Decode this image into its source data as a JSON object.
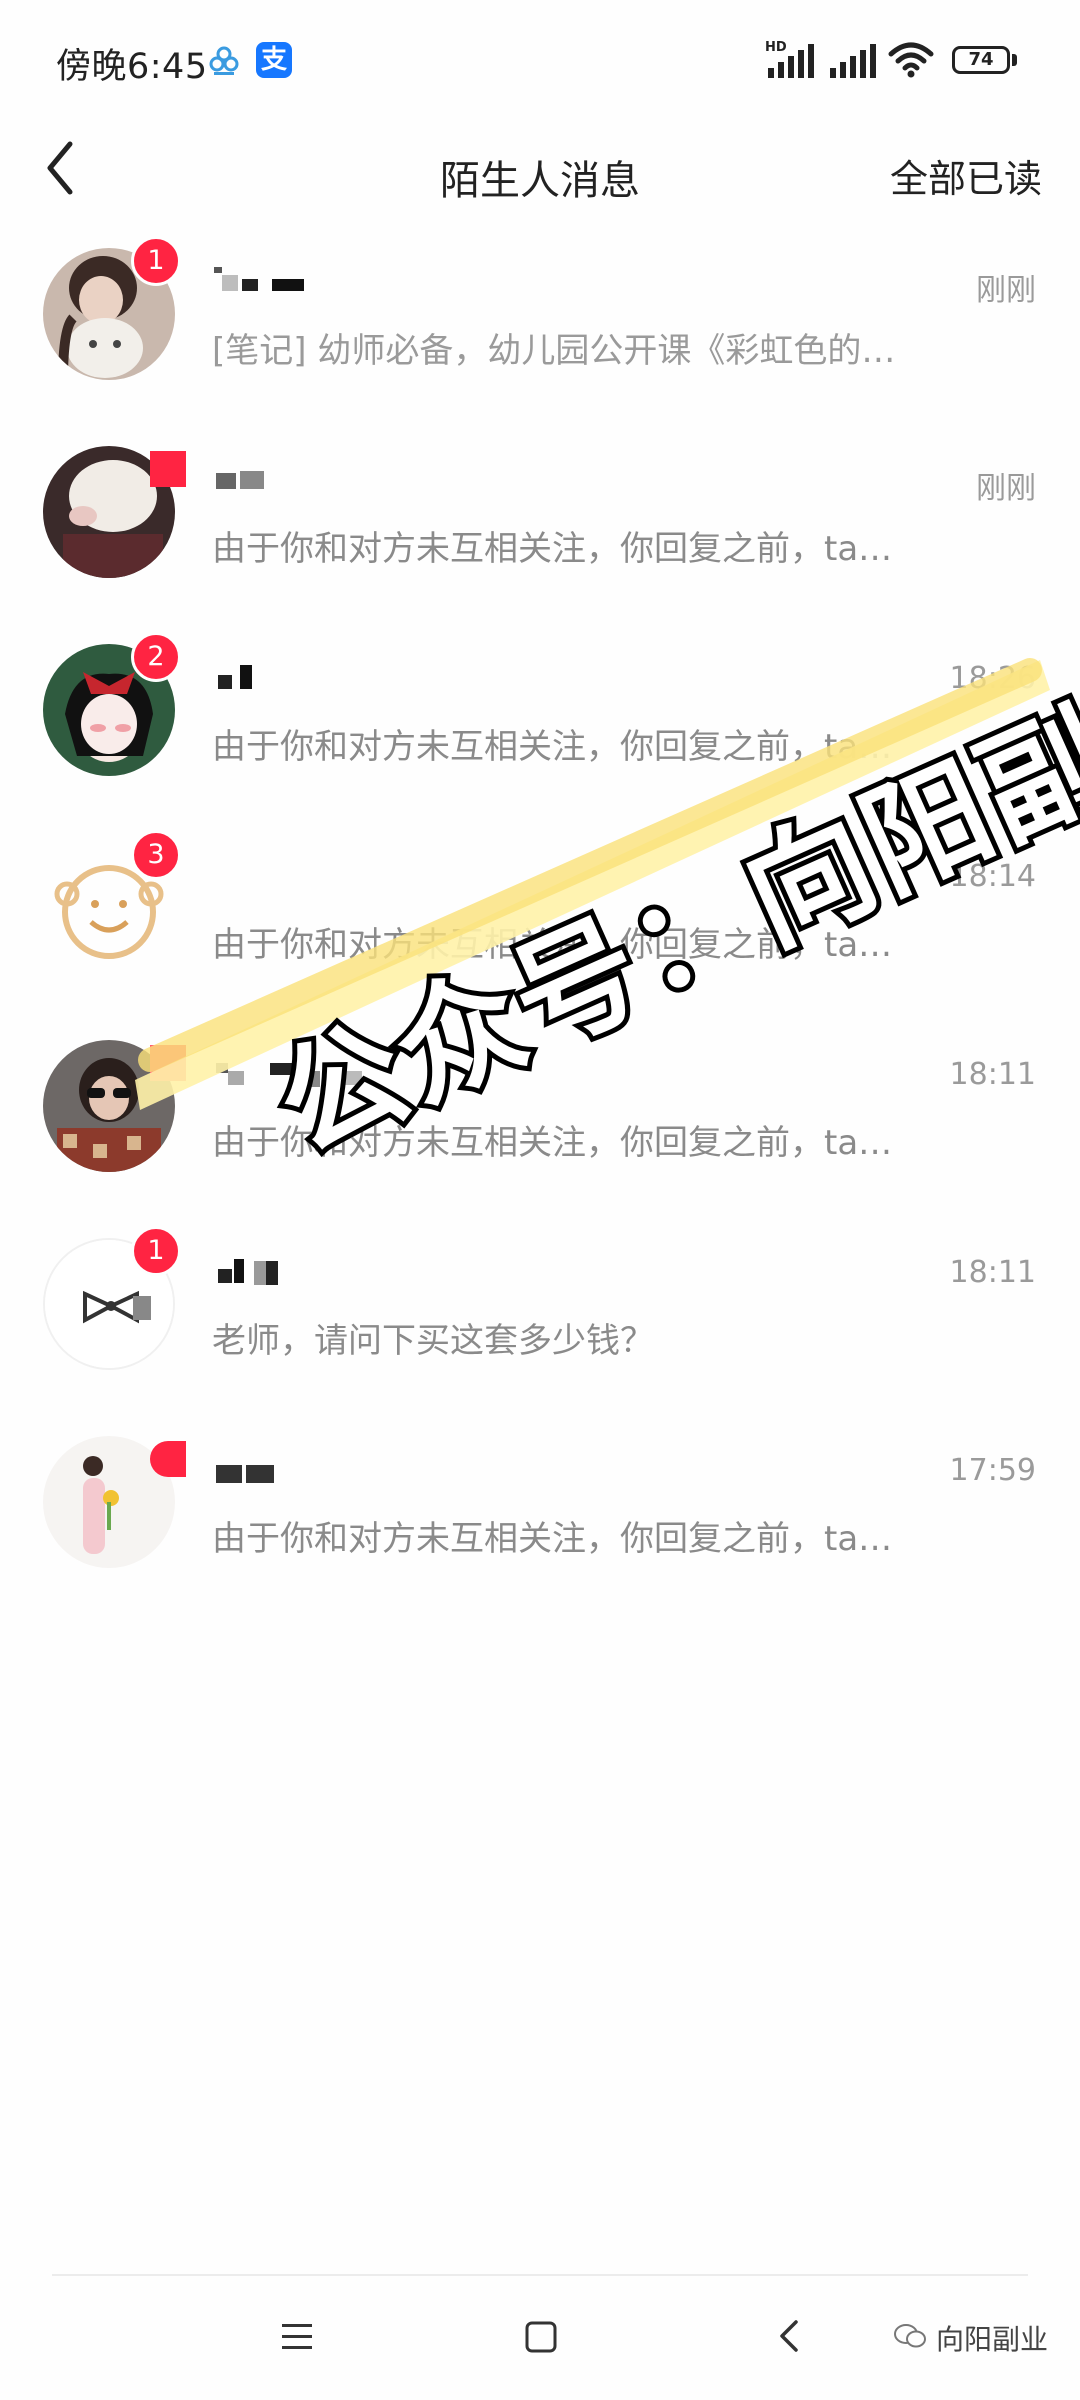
{
  "status_bar": {
    "time": "傍晚6:45",
    "network_label": "HD",
    "battery_level": "74",
    "icons": [
      "cloud-app-icon",
      "alipay-icon",
      "signal-icon",
      "signal-icon",
      "wifi-icon",
      "battery-icon"
    ]
  },
  "header": {
    "title": "陌生人消息",
    "action_label": "全部已读",
    "back_icon": "chevron-left-icon"
  },
  "messages": [
    {
      "name": "",
      "time": "刚刚",
      "preview": "[笔记] 幼师必备，幼儿园公开课《彩虹色的…",
      "badge": "1"
    },
    {
      "name": "",
      "time": "刚刚",
      "preview": "由于你和对方未互相关注，你回复之前，ta…",
      "badge": ""
    },
    {
      "name": "",
      "time": "18:26",
      "preview": "由于你和对方未互相关注，你回复之前，ta…",
      "badge": "2"
    },
    {
      "name": "",
      "time": "18:14",
      "preview": "由于你和对方未互相关注，你回复之前，ta…",
      "badge": "3"
    },
    {
      "name": "",
      "time": "18:11",
      "preview": "由于你和对方未互相关注，你回复之前，ta…",
      "badge": ""
    },
    {
      "name": "",
      "time": "18:11",
      "preview": "老师，请问下买这套多少钱？",
      "badge": "1"
    },
    {
      "name": "",
      "time": "17:59",
      "preview": "由于你和对方未互相关注，你回复之前，ta…",
      "badge": ""
    }
  ],
  "watermark": {
    "text": "公众号：向阳副业",
    "footer_text": "向阳副业"
  },
  "nav_bar": {
    "icons": [
      "menu-icon",
      "home-icon",
      "back-icon"
    ]
  },
  "colors": {
    "badge": "#ff2442",
    "text_primary": "#222222",
    "text_secondary": "#9a9a9a",
    "watermark_highlight": "#fff2a8"
  }
}
